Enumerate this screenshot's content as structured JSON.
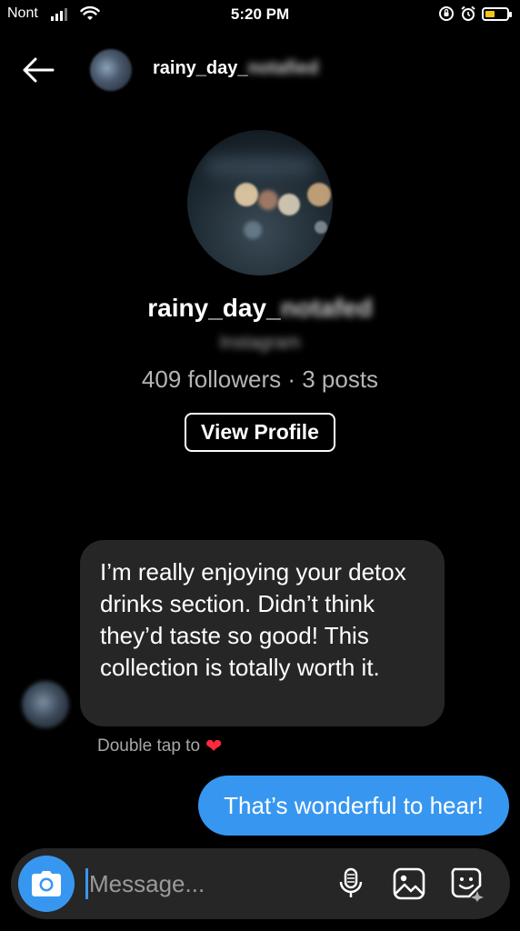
{
  "status_bar": {
    "carrier": "Nont",
    "time": "5:20 PM",
    "icons": [
      "signal-icon",
      "wifi-icon",
      "orientation-lock-icon",
      "alarm-icon",
      "battery-icon"
    ],
    "battery_color": "#f5c518"
  },
  "header": {
    "username_visible": "rainy_day_",
    "username_blurred": "notafied",
    "back_icon": "back-arrow-icon"
  },
  "profile": {
    "name_visible": "rainy_day_",
    "name_blurred": "notafed",
    "subtitle_blurred": "Instagram",
    "stats": "409 followers · 3 posts",
    "view_profile_label": "View Profile"
  },
  "messages": {
    "incoming_text": "I’m really enjoying your detox drinks section. Didn’t think they’d taste so good! This collection is totally worth it.",
    "double_tap_text": "Double tap to",
    "heart_icon": "heart-icon",
    "outgoing_text": "That’s wonderful to hear!"
  },
  "composer": {
    "placeholder": "Message...",
    "icons": [
      "camera-icon",
      "microphone-icon",
      "gallery-icon",
      "sticker-icon"
    ]
  },
  "colors": {
    "accent": "#3797f0",
    "bubble_incoming": "#262626",
    "background": "#000000",
    "heart": "#ff2a3d"
  }
}
